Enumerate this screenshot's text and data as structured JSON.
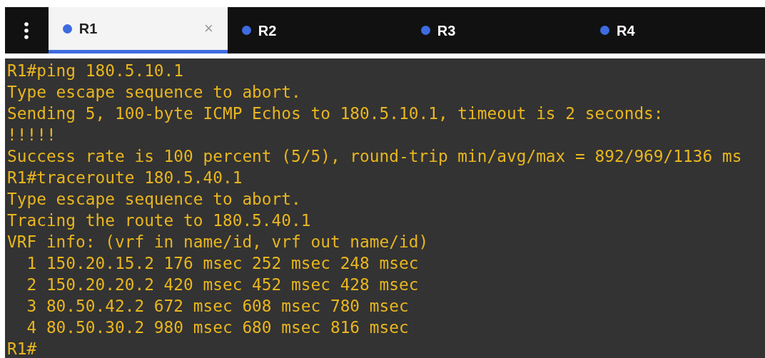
{
  "tabs": [
    {
      "label": "R1",
      "selected": true,
      "color": "#3d6be0",
      "close": "×"
    },
    {
      "label": "R2",
      "selected": false,
      "color": "#3d6be0"
    },
    {
      "label": "R3",
      "selected": false,
      "color": "#3d6be0"
    },
    {
      "label": "R4",
      "selected": false,
      "color": "#3d6be0"
    }
  ],
  "terminal": {
    "lines": [
      "R1#ping 180.5.10.1",
      "Type escape sequence to abort.",
      "Sending 5, 100-byte ICMP Echos to 180.5.10.1, timeout is 2 seconds:",
      "!!!!!",
      "Success rate is 100 percent (5/5), round-trip min/avg/max = 892/969/1136 ms",
      "R1#traceroute 180.5.40.1",
      "Type escape sequence to abort.",
      "Tracing the route to 180.5.40.1",
      "VRF info: (vrf in name/id, vrf out name/id)",
      "  1 150.20.15.2 176 msec 252 msec 248 msec",
      "  2 150.20.20.2 420 msec 452 msec 428 msec",
      "  3 80.50.42.2 672 msec 608 msec 780 msec",
      "  4 80.50.30.2 980 msec 680 msec 816 msec",
      "R1#"
    ]
  }
}
